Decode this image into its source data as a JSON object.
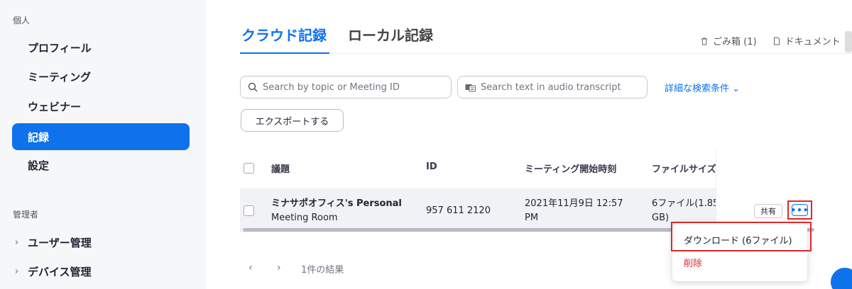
{
  "sidebar": {
    "personal_label": "個人",
    "items": [
      {
        "label": "プロフィール"
      },
      {
        "label": "ミーティング"
      },
      {
        "label": "ウェビナー"
      },
      {
        "label": "記録"
      },
      {
        "label": "設定"
      }
    ],
    "admin_label": "管理者",
    "admin_items": [
      {
        "label": "ユーザー管理"
      },
      {
        "label": "デバイス管理"
      }
    ]
  },
  "tabs": [
    {
      "label": "クラウド記録",
      "active": true
    },
    {
      "label": "ローカル記録",
      "active": false
    }
  ],
  "top_links": {
    "trash": "ごみ箱 (1)",
    "docs": "ドキュメント"
  },
  "search": {
    "topic_placeholder": "Search by topic or Meeting ID",
    "transcript_placeholder": "Search text in audio transcript",
    "advanced": "詳細な検索条件"
  },
  "export_label": "エクスポートする",
  "table": {
    "headers": [
      "議題",
      "ID",
      "ミーティング開始時刻",
      "ファイルサイズ"
    ],
    "rows": [
      {
        "topic_line1": "ミナサポオフィス's Personal",
        "topic_line2": "Meeting Room",
        "id": "957 611 2120",
        "start_line1": "2021年11月9日 12:57",
        "start_line2": "PM",
        "size_line1": "6ファイル(1.85",
        "size_line2": "GB)"
      }
    ]
  },
  "actions": {
    "share": "共有",
    "more": "•••",
    "menu": {
      "download": "ダウンロード (6ファイル)",
      "delete": "削除"
    }
  },
  "pager": {
    "prev": "‹",
    "next": "›",
    "result_count": "1件の結果"
  },
  "colors": {
    "accent": "#0e72ed",
    "danger": "#e02828"
  }
}
